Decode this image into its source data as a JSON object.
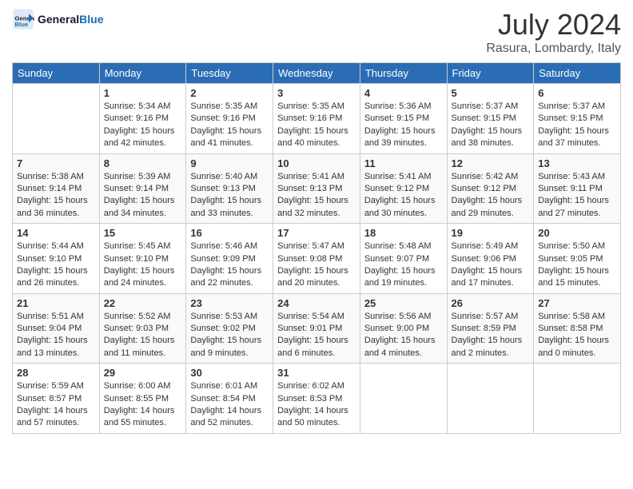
{
  "logo": {
    "line1": "General",
    "line2": "Blue",
    "icon": "▶"
  },
  "title": "July 2024",
  "location": "Rasura, Lombardy, Italy",
  "headers": [
    "Sunday",
    "Monday",
    "Tuesday",
    "Wednesday",
    "Thursday",
    "Friday",
    "Saturday"
  ],
  "weeks": [
    [
      {
        "day": "",
        "info": ""
      },
      {
        "day": "1",
        "info": "Sunrise: 5:34 AM\nSunset: 9:16 PM\nDaylight: 15 hours\nand 42 minutes."
      },
      {
        "day": "2",
        "info": "Sunrise: 5:35 AM\nSunset: 9:16 PM\nDaylight: 15 hours\nand 41 minutes."
      },
      {
        "day": "3",
        "info": "Sunrise: 5:35 AM\nSunset: 9:16 PM\nDaylight: 15 hours\nand 40 minutes."
      },
      {
        "day": "4",
        "info": "Sunrise: 5:36 AM\nSunset: 9:15 PM\nDaylight: 15 hours\nand 39 minutes."
      },
      {
        "day": "5",
        "info": "Sunrise: 5:37 AM\nSunset: 9:15 PM\nDaylight: 15 hours\nand 38 minutes."
      },
      {
        "day": "6",
        "info": "Sunrise: 5:37 AM\nSunset: 9:15 PM\nDaylight: 15 hours\nand 37 minutes."
      }
    ],
    [
      {
        "day": "7",
        "info": "Sunrise: 5:38 AM\nSunset: 9:14 PM\nDaylight: 15 hours\nand 36 minutes."
      },
      {
        "day": "8",
        "info": "Sunrise: 5:39 AM\nSunset: 9:14 PM\nDaylight: 15 hours\nand 34 minutes."
      },
      {
        "day": "9",
        "info": "Sunrise: 5:40 AM\nSunset: 9:13 PM\nDaylight: 15 hours\nand 33 minutes."
      },
      {
        "day": "10",
        "info": "Sunrise: 5:41 AM\nSunset: 9:13 PM\nDaylight: 15 hours\nand 32 minutes."
      },
      {
        "day": "11",
        "info": "Sunrise: 5:41 AM\nSunset: 9:12 PM\nDaylight: 15 hours\nand 30 minutes."
      },
      {
        "day": "12",
        "info": "Sunrise: 5:42 AM\nSunset: 9:12 PM\nDaylight: 15 hours\nand 29 minutes."
      },
      {
        "day": "13",
        "info": "Sunrise: 5:43 AM\nSunset: 9:11 PM\nDaylight: 15 hours\nand 27 minutes."
      }
    ],
    [
      {
        "day": "14",
        "info": "Sunrise: 5:44 AM\nSunset: 9:10 PM\nDaylight: 15 hours\nand 26 minutes."
      },
      {
        "day": "15",
        "info": "Sunrise: 5:45 AM\nSunset: 9:10 PM\nDaylight: 15 hours\nand 24 minutes."
      },
      {
        "day": "16",
        "info": "Sunrise: 5:46 AM\nSunset: 9:09 PM\nDaylight: 15 hours\nand 22 minutes."
      },
      {
        "day": "17",
        "info": "Sunrise: 5:47 AM\nSunset: 9:08 PM\nDaylight: 15 hours\nand 20 minutes."
      },
      {
        "day": "18",
        "info": "Sunrise: 5:48 AM\nSunset: 9:07 PM\nDaylight: 15 hours\nand 19 minutes."
      },
      {
        "day": "19",
        "info": "Sunrise: 5:49 AM\nSunset: 9:06 PM\nDaylight: 15 hours\nand 17 minutes."
      },
      {
        "day": "20",
        "info": "Sunrise: 5:50 AM\nSunset: 9:05 PM\nDaylight: 15 hours\nand 15 minutes."
      }
    ],
    [
      {
        "day": "21",
        "info": "Sunrise: 5:51 AM\nSunset: 9:04 PM\nDaylight: 15 hours\nand 13 minutes."
      },
      {
        "day": "22",
        "info": "Sunrise: 5:52 AM\nSunset: 9:03 PM\nDaylight: 15 hours\nand 11 minutes."
      },
      {
        "day": "23",
        "info": "Sunrise: 5:53 AM\nSunset: 9:02 PM\nDaylight: 15 hours\nand 9 minutes."
      },
      {
        "day": "24",
        "info": "Sunrise: 5:54 AM\nSunset: 9:01 PM\nDaylight: 15 hours\nand 6 minutes."
      },
      {
        "day": "25",
        "info": "Sunrise: 5:56 AM\nSunset: 9:00 PM\nDaylight: 15 hours\nand 4 minutes."
      },
      {
        "day": "26",
        "info": "Sunrise: 5:57 AM\nSunset: 8:59 PM\nDaylight: 15 hours\nand 2 minutes."
      },
      {
        "day": "27",
        "info": "Sunrise: 5:58 AM\nSunset: 8:58 PM\nDaylight: 15 hours\nand 0 minutes."
      }
    ],
    [
      {
        "day": "28",
        "info": "Sunrise: 5:59 AM\nSunset: 8:57 PM\nDaylight: 14 hours\nand 57 minutes."
      },
      {
        "day": "29",
        "info": "Sunrise: 6:00 AM\nSunset: 8:55 PM\nDaylight: 14 hours\nand 55 minutes."
      },
      {
        "day": "30",
        "info": "Sunrise: 6:01 AM\nSunset: 8:54 PM\nDaylight: 14 hours\nand 52 minutes."
      },
      {
        "day": "31",
        "info": "Sunrise: 6:02 AM\nSunset: 8:53 PM\nDaylight: 14 hours\nand 50 minutes."
      },
      {
        "day": "",
        "info": ""
      },
      {
        "day": "",
        "info": ""
      },
      {
        "day": "",
        "info": ""
      }
    ]
  ]
}
